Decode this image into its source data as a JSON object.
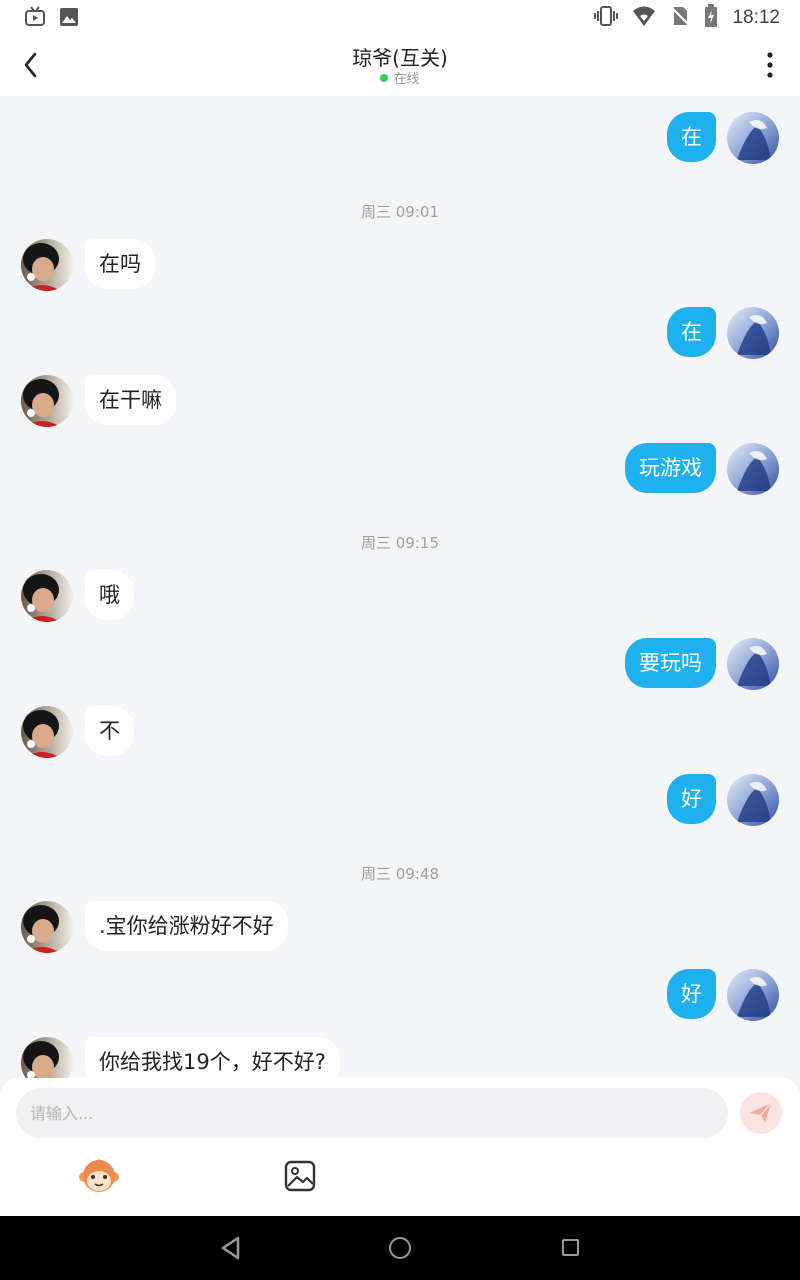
{
  "status_bar": {
    "time": "18:12"
  },
  "header": {
    "title": "琼爷(互关)",
    "status": "在线"
  },
  "timestamps": [
    "周三 09:01",
    "周三 09:15",
    "周三 09:48"
  ],
  "messages": [
    {
      "side": "out",
      "text": "在"
    },
    {
      "side": "in",
      "text": "在吗"
    },
    {
      "side": "out",
      "text": "在"
    },
    {
      "side": "in",
      "text": "在干嘛"
    },
    {
      "side": "out",
      "text": "玩游戏"
    },
    {
      "side": "in",
      "text": "哦"
    },
    {
      "side": "out",
      "text": "要玩吗"
    },
    {
      "side": "in",
      "text": "不"
    },
    {
      "side": "out",
      "text": "好"
    },
    {
      "side": "in",
      "text": ".宝你给涨粉好不好"
    },
    {
      "side": "out",
      "text": "好"
    },
    {
      "side": "in",
      "text": "你给我找19个，好不好?"
    }
  ],
  "composer": {
    "placeholder": "请输入..."
  },
  "colors": {
    "outgoing_bubble": "#1fb0f0",
    "incoming_bubble": "#ffffff",
    "online_dot": "#33cc55"
  }
}
